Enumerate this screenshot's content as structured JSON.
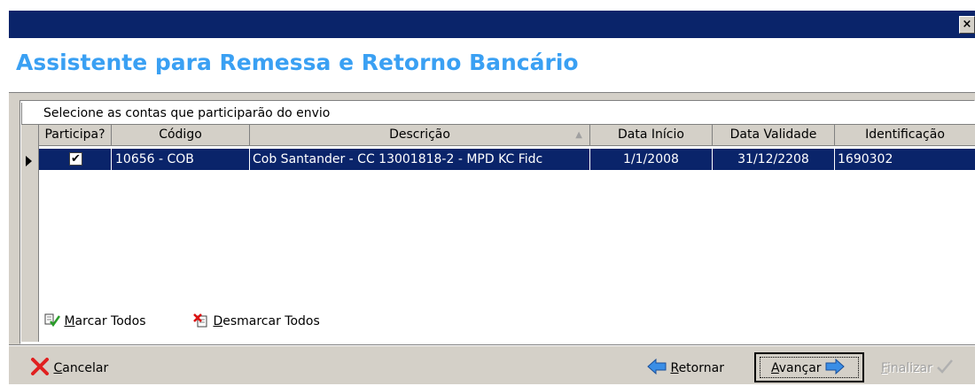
{
  "window": {
    "close_label": "×",
    "title": "Assistente para Remessa e Retorno Bancário"
  },
  "grid": {
    "caption": "Selecione as contas que participarão do envio",
    "columns": [
      "Participa?",
      "Código",
      "Descrição",
      "Data Início",
      "Data Validade",
      "Identificação"
    ],
    "sort_indicator": "▲",
    "rows": [
      {
        "participa": true,
        "codigo": "10656 - COB",
        "descricao": "Cob Santander - CC 13001818-2 - MPD KC Fidc",
        "data_inicio": "1/1/2008",
        "data_validade": "31/12/2208",
        "identificacao": "1690302"
      }
    ]
  },
  "actions": {
    "marcar_todos": {
      "mnemonic": "M",
      "rest": "arcar Todos"
    },
    "desmarcar_todos": {
      "mnemonic": "D",
      "rest": "esmarcar Todos"
    }
  },
  "footer": {
    "cancelar": {
      "mnemonic": "C",
      "rest": "ancelar"
    },
    "retornar": {
      "mnemonic": "R",
      "rest": "etornar"
    },
    "avancar": {
      "mnemonic": "A",
      "rest": "vançar"
    },
    "finalizar": {
      "mnemonic": "F",
      "rest": "inalizar"
    }
  },
  "colors": {
    "title_blue": "#3aa0f3",
    "selection": "#0a246a",
    "chrome": "#d4d0c8"
  },
  "icons": [
    "close-icon",
    "row-pointer-icon",
    "check-icon",
    "sort-asc-icon",
    "marcar-todos-icon",
    "desmarcar-todos-icon",
    "cancel-x-icon",
    "arrow-left-icon",
    "arrow-right-icon",
    "finalizar-check-icon"
  ]
}
